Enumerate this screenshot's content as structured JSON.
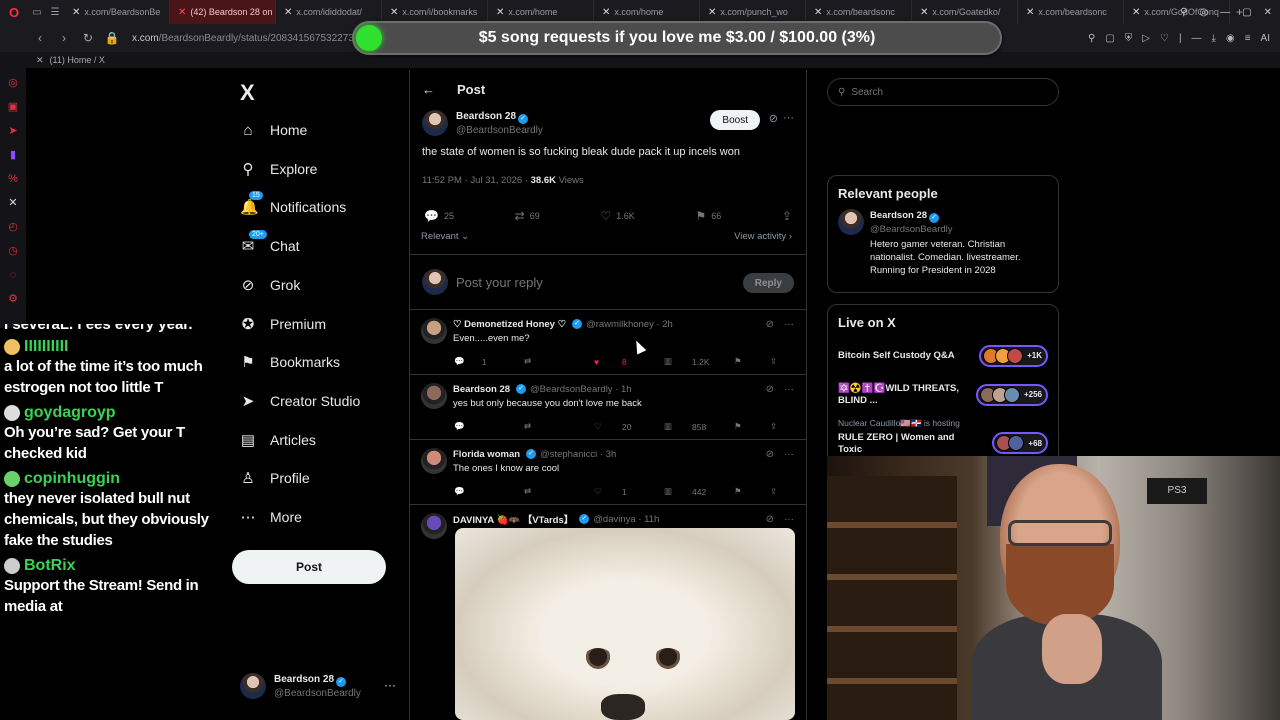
{
  "browser": {
    "tabs": [
      {
        "label": "x.com/BeardsonBe",
        "active": false
      },
      {
        "label": "(42) Beardson 28 on X: \"t",
        "active": true
      },
      {
        "label": "x.com/ididdodat/",
        "active": false
      },
      {
        "label": "x.com/i/bookmarks",
        "active": false
      },
      {
        "label": "x.com/home",
        "active": false
      },
      {
        "label": "x.com/home",
        "active": false
      },
      {
        "label": "x.com/punch_wo",
        "active": false
      },
      {
        "label": "x.com/beardsonc",
        "active": false
      },
      {
        "label": "x.com/Goatedko/",
        "active": false
      },
      {
        "label": "x.com/beardsonc",
        "active": false
      },
      {
        "label": "x.com/GodOfConq",
        "active": false
      }
    ],
    "url_host": "x.com",
    "url_path": "/BeardsonBeardly/status/2083415675322732815",
    "subtab": "(11) Home / X",
    "ai_label": "AI"
  },
  "banner": {
    "text": "$5 song requests if you love me $3.00 / $100.00 (3%)",
    "progress_fraction": 0.03,
    "accent": "#2fe02f"
  },
  "chat": {
    "cutoff_line": "I severaL. I ees every year.",
    "messages": [
      {
        "user": "IIIIIIIIII",
        "user_color": "#39d353",
        "avatar_color": "#f0c060",
        "text": "a lot of the time it’s too much estrogen not too little T"
      },
      {
        "user": "goydagroyp",
        "user_color": "#39d353",
        "avatar_color": "#dddddd",
        "text": "Oh you’re sad? Get your T checked kid"
      },
      {
        "user": "copinhuggin",
        "user_color": "#39d353",
        "avatar_color": "#6ad06a",
        "text": "they never isolated bull nut chemicals, but they obviously fake the studies"
      },
      {
        "user": "BotRix",
        "user_color": "#39d353",
        "avatar_color": "#cccccc",
        "text": "Support the Stream! Send in media at"
      }
    ]
  },
  "nav": {
    "logo": "X",
    "items": [
      {
        "label": "Home",
        "icon": "⌂",
        "badge": ""
      },
      {
        "label": "Explore",
        "icon": "⚲",
        "badge": ""
      },
      {
        "label": "Notifications",
        "icon": "🔔",
        "badge": "15"
      },
      {
        "label": "Chat",
        "icon": "✉",
        "badge": "20+"
      },
      {
        "label": "Grok",
        "icon": "⊘",
        "badge": ""
      },
      {
        "label": "Premium",
        "icon": "✪",
        "badge": ""
      },
      {
        "label": "Bookmarks",
        "icon": "⚑",
        "badge": ""
      },
      {
        "label": "Creator Studio",
        "icon": "➤",
        "badge": ""
      },
      {
        "label": "Articles",
        "icon": "▤",
        "badge": ""
      },
      {
        "label": "Profile",
        "icon": "♙",
        "badge": ""
      },
      {
        "label": "More",
        "icon": "⋯",
        "badge": ""
      }
    ],
    "post_label": "Post",
    "me_name": "Beardson 28",
    "me_handle": "@BeardsonBeardly"
  },
  "post": {
    "header": "Post",
    "author": "Beardson 28",
    "handle": "@BeardsonBeardly",
    "boost_label": "Boost",
    "text": "the state of women is so fucking bleak dude pack it up incels won",
    "time": "11:52 PM · Jul 31, 2026 · ",
    "views_count": "38.6K",
    "views_label": " Views",
    "replies": "25",
    "reposts": "69",
    "likes": "1.6K",
    "bookmarks": "66",
    "sort_label": "Relevant ⌄",
    "activity_label": "View activity ›",
    "reply_placeholder": "Post your reply",
    "reply_button": "Reply"
  },
  "replies": [
    {
      "name": "♡ Demonetized Honey ♡",
      "handle": "@rawmilkhoney · 2h",
      "text": "Even.....even me?",
      "replies": "1",
      "reposts": "",
      "likes": "8",
      "views": "1.2K",
      "liked": true,
      "avatar": "#c9a084"
    },
    {
      "name": "Beardson 28",
      "handle": "@BeardsonBeardly · 1h",
      "text": "yes but only because you don't love me back",
      "replies": "",
      "reposts": "",
      "likes": "20",
      "views": "858",
      "liked": false,
      "avatar": "#8a6a5a"
    },
    {
      "name": "Florida woman",
      "handle": "@stephanicci · 3h",
      "text": "The ones I know are cool",
      "replies": "",
      "reposts": "",
      "likes": "1",
      "views": "442",
      "liked": false,
      "avatar": "#d08a7a"
    },
    {
      "name": "DAVINYA 🍓🦇 【VTards】",
      "handle": "@davinya · 11h",
      "text": "",
      "replies": "",
      "reposts": "",
      "likes": "",
      "views": "",
      "liked": false,
      "avatar": "#6a4ab8"
    }
  ],
  "right": {
    "search_placeholder": "Search",
    "relevant_title": "Relevant people",
    "rp_name": "Beardson 28",
    "rp_handle": "@BeardsonBeardly",
    "rp_bio": "Hetero gamer veteran. Christian nationalist. Comedian. livestreamer. Running for President in 2028",
    "live_title": "Live on X",
    "live": [
      {
        "title": "Bitcoin Self Custody Q&A",
        "count": "+1K",
        "colors": [
          "#e07a2a",
          "#f0a040",
          "#c04a4a"
        ]
      },
      {
        "title": "🔯☢️✝️☪️WILD THREATS, BLIND ...",
        "count": "+256",
        "colors": [
          "#8a6a5a",
          "#c0a090",
          "#6a8ab0"
        ]
      },
      {
        "title": "RULE ZERO | Women and Toxic",
        "count": "+68",
        "colors": [
          "#aa5050",
          "#5060a0"
        ],
        "host": "Nuclear Caudillo🇺🇸🇩🇴 is hosting"
      }
    ]
  },
  "webcam": {
    "shelf_label": "PS3"
  }
}
